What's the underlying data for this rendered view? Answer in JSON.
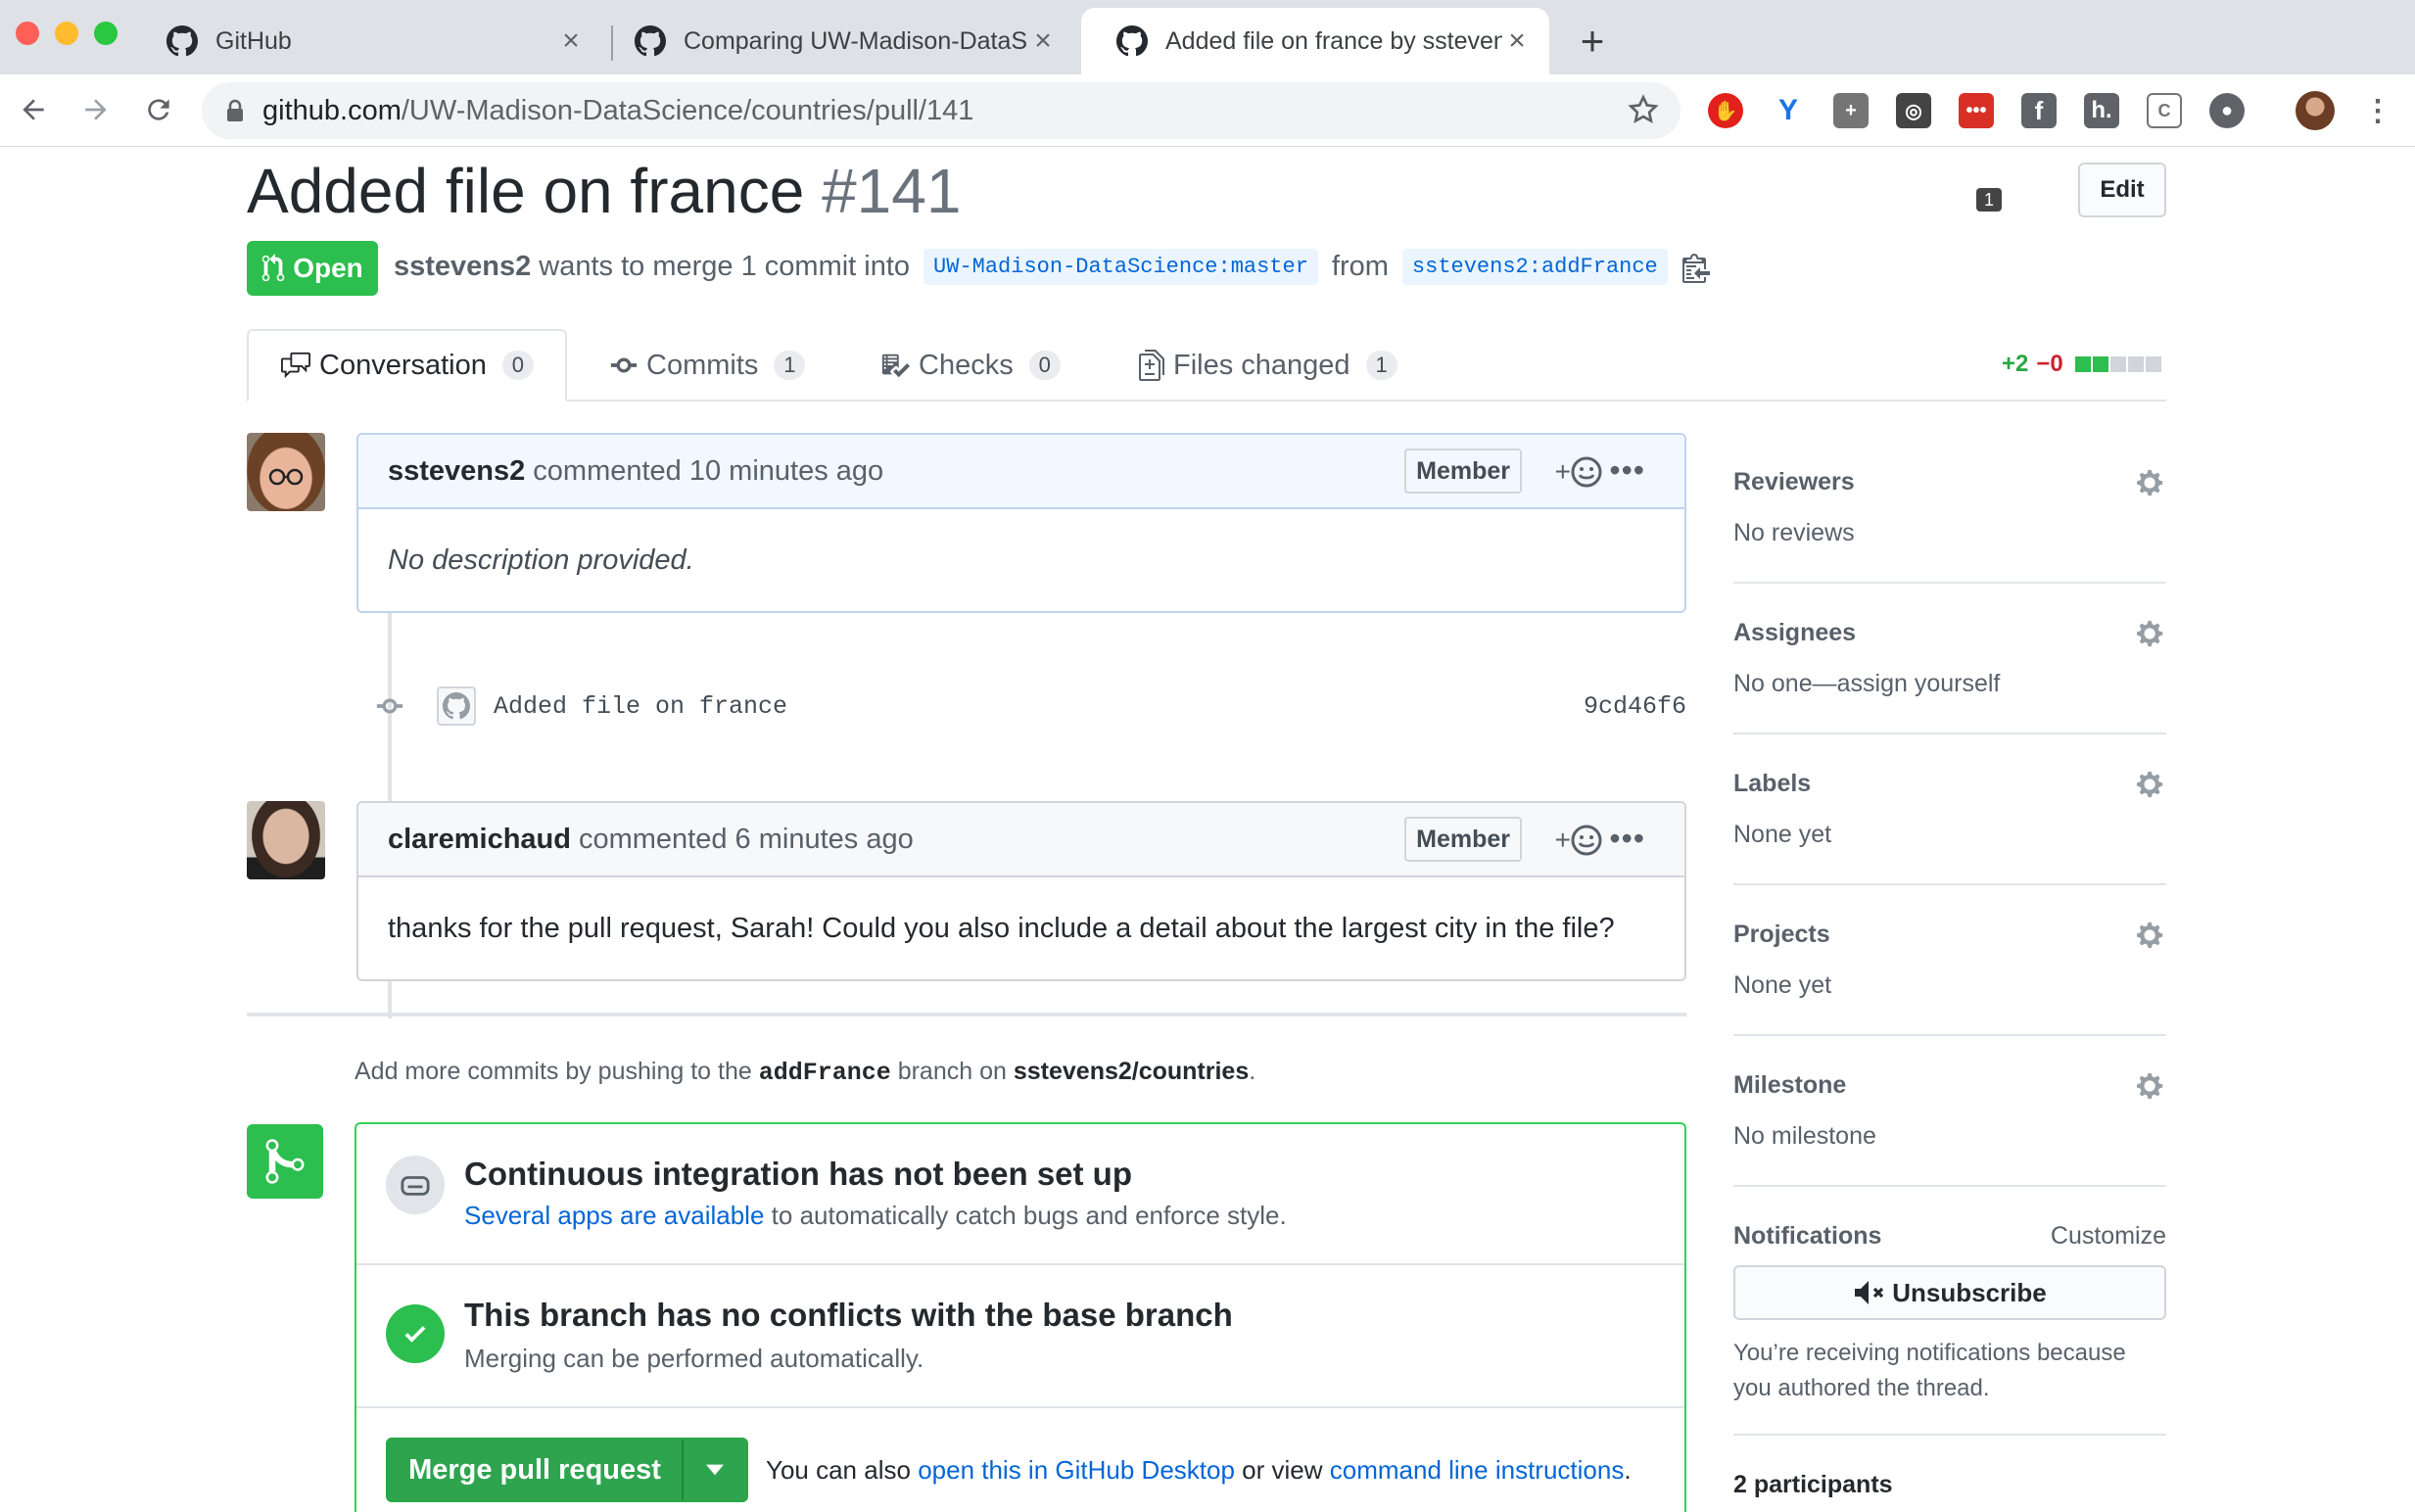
{
  "browser": {
    "tabs": [
      {
        "title": "GitHub",
        "active": false
      },
      {
        "title": "Comparing UW-Madison-DataS",
        "active": false
      },
      {
        "title": "Added file on france by ssteven",
        "active": true
      }
    ],
    "close_glyph": "×",
    "new_tab_glyph": "+",
    "url_host": "github.com",
    "url_path": "/UW-Madison-DataScience/countries/pull/141",
    "extension_badge": "1"
  },
  "pr": {
    "title": "Added file on france",
    "number": "#141",
    "edit_label": "Edit",
    "state": "Open",
    "author": "sstevens2",
    "merge_text": "wants to merge 1 commit into",
    "base_branch": "UW-Madison-DataScience:master",
    "from_text": "from",
    "head_branch": "sstevens2:addFrance"
  },
  "tabs": [
    {
      "label": "Conversation",
      "count": "0"
    },
    {
      "label": "Commits",
      "count": "1"
    },
    {
      "label": "Checks",
      "count": "0"
    },
    {
      "label": "Files changed",
      "count": "1"
    }
  ],
  "diffstat": {
    "additions": "+2",
    "deletions": "−0"
  },
  "comments": [
    {
      "author": "sstevens2",
      "meta": "commented 10 minutes ago",
      "badge": "Member",
      "body": "No description provided."
    },
    {
      "author": "claremichaud",
      "meta": "commented 6 minutes ago",
      "badge": "Member",
      "body": "thanks for the pull request, Sarah! Could you also include a detail about the largest city in the file?"
    }
  ],
  "commit": {
    "message": "Added file on france",
    "sha": "9cd46f6"
  },
  "hint": {
    "prefix": "Add more commits by pushing to the",
    "branch": "addFrance",
    "middle": "branch on",
    "repo": "sstevens2/countries",
    "suffix": "."
  },
  "merge": {
    "ci_title": "Continuous integration has not been set up",
    "ci_link": "Several apps are available",
    "ci_rest": "to automatically catch bugs and enforce style.",
    "conflict_title": "This branch has no conflicts with the base branch",
    "conflict_sub": "Merging can be performed automatically.",
    "button_label": "Merge pull request",
    "alt_prefix": "You can also",
    "alt_link1": "open this in GitHub Desktop",
    "alt_mid": "or view",
    "alt_link2": "command line instructions",
    "alt_suffix": "."
  },
  "sidebar": {
    "reviewers": {
      "title": "Reviewers",
      "value": "No reviews"
    },
    "assignees": {
      "title": "Assignees",
      "value": "No one—assign yourself"
    },
    "labels": {
      "title": "Labels",
      "value": "None yet"
    },
    "projects": {
      "title": "Projects",
      "value": "None yet"
    },
    "milestone": {
      "title": "Milestone",
      "value": "No milestone"
    },
    "notifications": {
      "title": "Notifications",
      "customize": "Customize",
      "button": "Unsubscribe",
      "text": "You’re receiving notifications because you authored the thread."
    },
    "participants": "2 participants"
  },
  "colors": {
    "open_green": "#2cbe4e",
    "link_blue": "#0366d6",
    "deletion_red": "#cb2431"
  }
}
